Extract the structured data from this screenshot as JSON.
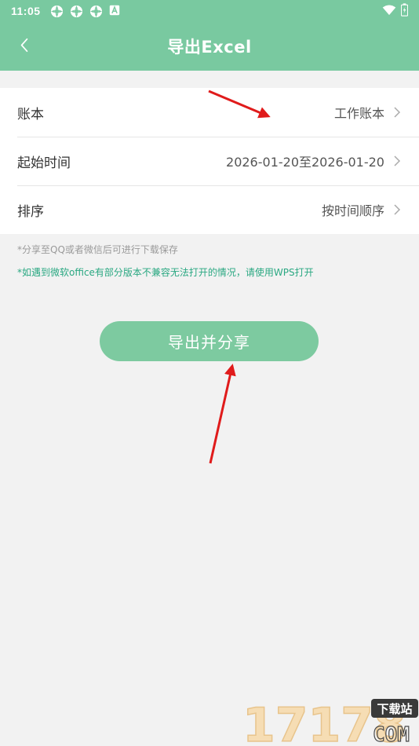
{
  "status_bar": {
    "time": "11:05"
  },
  "app_bar": {
    "title": "导出Excel"
  },
  "settings": [
    {
      "label": "账本",
      "value": "工作账本"
    },
    {
      "label": "起始时间",
      "value": "2026-01-20至2026-01-20"
    },
    {
      "label": "排序",
      "value": "按时间顺序"
    }
  ],
  "notes": {
    "share_tip": "*分享至QQ或者微信后可进行下载保存",
    "compat_tip": "*如遇到微软office有部分版本不兼容无法打开的情况，请使用WPS打开"
  },
  "export_button": {
    "label": "导出并分享"
  },
  "watermark": {
    "brand": "17178",
    "tag": "下载站",
    "domain": "COM"
  },
  "colors": {
    "accent": "#79c9a0",
    "button": "#7dcaa0",
    "tip_green": "#2aa882",
    "annotation_arrow": "#e01b1b"
  }
}
